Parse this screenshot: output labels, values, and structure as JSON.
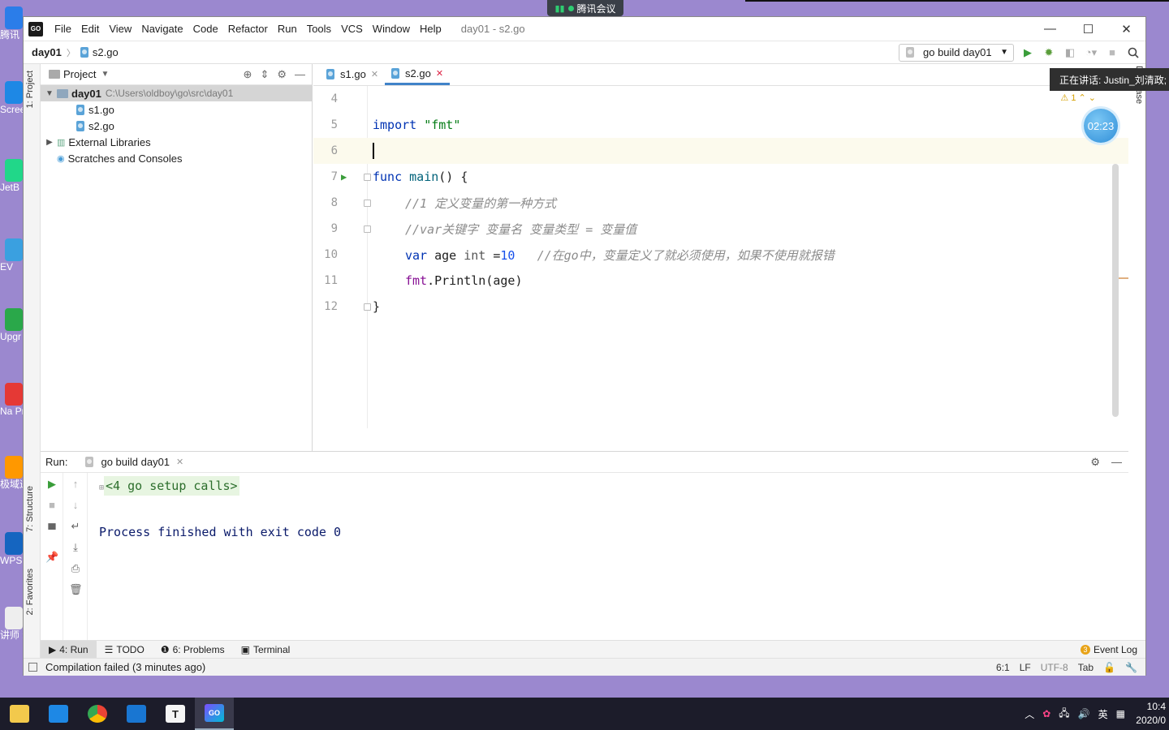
{
  "meeting": {
    "label": "腾讯会议",
    "speaker": "正在讲话: Justin_刘清政;",
    "timer": "02:23"
  },
  "desktop": {
    "icons": [
      {
        "label": "腾讯",
        "color": "#2b7de9"
      },
      {
        "label": "Scree",
        "color": "#1e88e5"
      },
      {
        "label": "JetB PyCha",
        "color": "#21d789"
      },
      {
        "label": "EV",
        "color": "#3aa0e0"
      },
      {
        "label": "Upgr",
        "color": "#2aa84a"
      },
      {
        "label": "Na Prem",
        "color": "#e53935"
      },
      {
        "label": "极域遥 系统",
        "color": "#ff9800"
      },
      {
        "label": "WPS",
        "color": "#1565c0"
      },
      {
        "label": "讲师 绍",
        "color": "#eeeeee"
      }
    ]
  },
  "window": {
    "logo": "GO",
    "title": "day01 - s2.go"
  },
  "menu": [
    "File",
    "Edit",
    "View",
    "Navigate",
    "Code",
    "Refactor",
    "Run",
    "Tools",
    "VCS",
    "Window",
    "Help"
  ],
  "breadcrumb": {
    "project": "day01",
    "file": "s2.go"
  },
  "run_config": {
    "label": "go build day01"
  },
  "side_tabs": {
    "project": "1: Project",
    "structure": "7: Structure",
    "favorites": "2: Favorites",
    "database": "Database"
  },
  "project_panel": {
    "title": "Project",
    "root": {
      "name": "day01",
      "path": "C:\\Users\\oldboy\\go\\src\\day01"
    },
    "files": [
      "s1.go",
      "s2.go"
    ],
    "external": "External Libraries",
    "scratches": "Scratches and Consoles"
  },
  "editor": {
    "tabs": [
      {
        "label": "s1.go",
        "active": false
      },
      {
        "label": "s2.go",
        "active": true
      }
    ],
    "warning_count": "1",
    "line_numbers": [
      "4",
      "5",
      "6",
      "7",
      "8",
      "9",
      "10",
      "11",
      "12"
    ],
    "code": {
      "l5_kw": "import",
      "l5_str": "\"fmt\"",
      "l7_kw": "func",
      "l7_fn": "main",
      "l7_rest": "() {",
      "l8": "//1 定义变量的第一种方式",
      "l9": "//var关键字 变量名 变量类型 = 变量值",
      "l10_kw": "var",
      "l10_name": " age ",
      "l10_type": "int",
      "l10_eq": " =",
      "l10_num": "10",
      "l10_cmt": "//在go中，变量定义了就必须使用，如果不使用就报错",
      "l11_pkg": "fmt",
      "l11_rest": ".Println(age)",
      "l12": "}"
    }
  },
  "run_panel": {
    "label": "Run:",
    "tab": "go build day01",
    "setup": "<4 go setup calls>",
    "result": "Process finished with exit code 0"
  },
  "tool_tabs": {
    "run": "4: Run",
    "todo": "TODO",
    "problems": "6: Problems",
    "terminal": "Terminal",
    "event_log": "Event Log",
    "event_count": "3"
  },
  "status": {
    "message": "Compilation failed (3 minutes ago)",
    "position": "6:1",
    "line_sep": "LF",
    "encoding": "UTF-8",
    "indent": "Tab"
  },
  "taskbar": {
    "ime": "英",
    "time": "10:4",
    "date": "2020/0"
  }
}
